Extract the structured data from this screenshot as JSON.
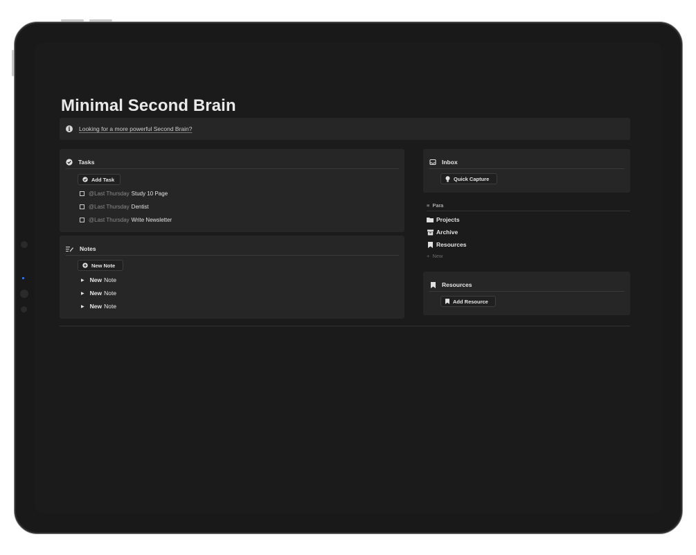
{
  "page": {
    "title": "Minimal Second Brain",
    "callout_text": "Looking for a more powerful Second Brain?"
  },
  "tasks": {
    "title": "Tasks",
    "add_button": "Add Task",
    "items": [
      {
        "mention": "@Last Thursday",
        "name": "Study 10 Page",
        "checked": false
      },
      {
        "mention": "@Last Thursday",
        "name": "Dentist",
        "checked": false
      },
      {
        "mention": "@Last Thursday",
        "name": "Write Newsletter",
        "checked": false
      }
    ]
  },
  "notes": {
    "title": "Notes",
    "add_button": "New Note",
    "items": [
      {
        "bold": "New",
        "rest": "Note"
      },
      {
        "bold": "New",
        "rest": "Note"
      },
      {
        "bold": "New",
        "rest": "Note"
      }
    ]
  },
  "inbox": {
    "title": "Inbox",
    "button": "Quick Capture"
  },
  "para": {
    "title": "Para",
    "items": [
      {
        "label": "Projects",
        "icon": "folder-icon"
      },
      {
        "label": "Archive",
        "icon": "archive-icon"
      },
      {
        "label": "Resources",
        "icon": "bookmark-icon"
      }
    ],
    "new_label": "New"
  },
  "resources": {
    "title": "Resources",
    "button": "Add Resource"
  },
  "colors": {
    "background": "#191919",
    "panel": "#262626",
    "text": "#e6e6e6",
    "muted": "#8b8b8b"
  }
}
